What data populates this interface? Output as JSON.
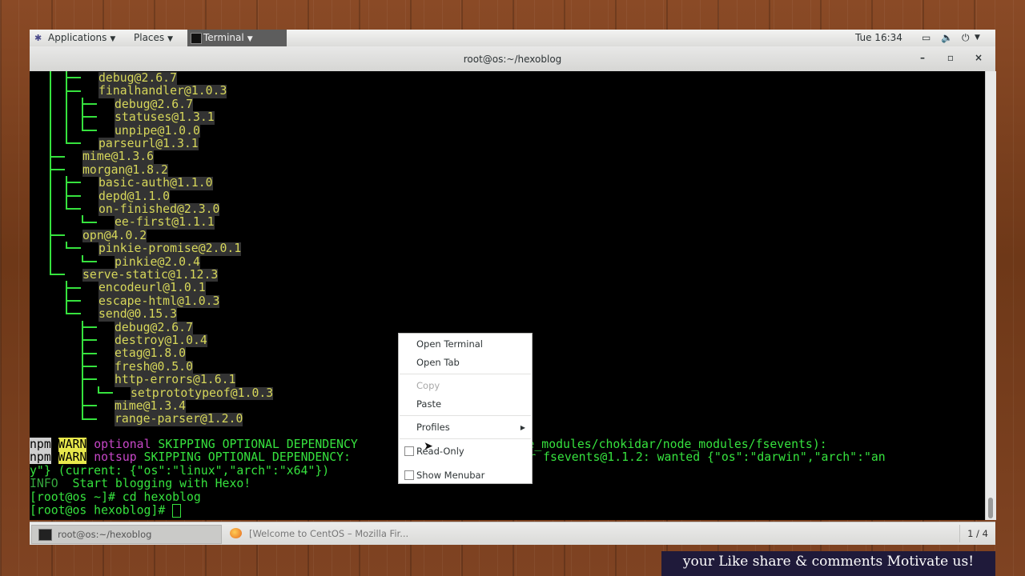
{
  "topbar": {
    "applications": "Applications",
    "places": "Places",
    "active_app": "Terminal",
    "clock": "Tue 16:34"
  },
  "window": {
    "title": "root@os:~/hexoblog",
    "minimize": "–",
    "maximize": "▫",
    "close": "×"
  },
  "terminal": {
    "tree_lines": [
      "debug@2.6.7",
      "finalhandler@1.0.3",
      "debug@2.6.7",
      "statuses@1.3.1",
      "unpipe@1.0.0",
      "parseurl@1.3.1",
      "mime@1.3.6",
      "morgan@1.8.2",
      "basic-auth@1.1.0",
      "depd@1.1.0",
      "on-finished@2.3.0",
      "ee-first@1.1.1",
      "opn@4.0.2",
      "pinkie-promise@2.0.1",
      "pinkie@2.0.4",
      "serve-static@1.12.3",
      "encodeurl@1.0.1",
      "escape-html@1.0.3",
      "send@0.15.3",
      "debug@2.6.7",
      "destroy@1.0.4",
      "etag@1.8.0",
      "fresh@0.5.0",
      "http-errors@1.6.1",
      "setprototypeof@1.0.3",
      "mime@1.3.4",
      "range-parser@1.2.0"
    ],
    "npm": "npm",
    "warn": "WARN",
    "optional": "optional",
    "notsup": "notsup",
    "line1_text": " SKIPPING OPTIONAL DEPENDENCY",
    "line1_tail": "(node_modules/chokidar/node_modules/fsevents):",
    "line2_text": " SKIPPING OPTIONAL DEPENDENCY: ",
    "line2_tail": "orm for fsevents@1.1.2: wanted {\"os\":\"darwin\",\"arch\":\"an",
    "line3": "y\"} (current: {\"os\":\"linux\",\"arch\":\"x64\"})",
    "info": "INFO",
    "info_msg": "  Start blogging with Hexo!",
    "prompt1": "[root@os ~]# cd hexoblog",
    "prompt2": "[root@os hexoblog]# "
  },
  "context_menu": {
    "open_terminal": "Open Terminal",
    "open_tab": "Open Tab",
    "copy": "Copy",
    "paste": "Paste",
    "profiles": "Profiles",
    "read_only": "Read-Only",
    "show_menubar": "Show Menubar"
  },
  "taskbar": {
    "task1": "root@os:~/hexoblog",
    "task2": "[Welcome to CentOS – Mozilla Fir...",
    "pager": "1 / 4"
  },
  "banner": "your Like share & comments Motivate us!",
  "colors": {
    "terminal_green": "#36e23e",
    "package_yellow": "#d7d75a",
    "warn_yellow": "#e8e84c",
    "magenta": "#c847c8"
  }
}
